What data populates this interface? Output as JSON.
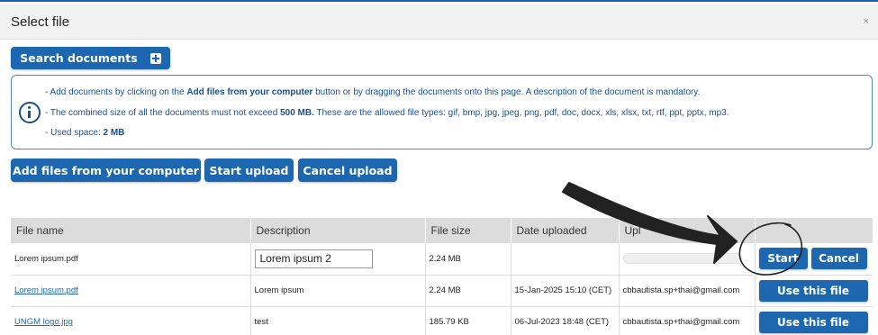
{
  "dialog": {
    "title": "Select file",
    "close_glyph": "×"
  },
  "toolbar": {
    "search_label": "Search documents",
    "add_files_label": "Add files from your computer",
    "start_upload_label": "Start upload",
    "cancel_upload_label": "Cancel upload"
  },
  "info": {
    "line1_pre": "- Add documents by clicking on the ",
    "line1_bold": "Add files from your computer",
    "line1_post": " button or by dragging the documents onto this page. A description of the document is mandatory.",
    "line2_pre": "- The combined size of all the documents must not exceed ",
    "line2_bold": "500 MB.",
    "line2_post": " These are the allowed file types: gif, bmp, jpg, jpeg, png, pdf, doc, docx, xls, xlsx, txt, rtf, ppt, pptx, mp3.",
    "line3_pre": "- Used space: ",
    "line3_bold": "2 MB"
  },
  "table": {
    "headers": [
      "File name",
      "Description",
      "File size",
      "Date uploaded",
      "Upl",
      ""
    ],
    "pending_row": {
      "file_name": "Lorem ipsum.pdf",
      "description_value": "Lorem ipsum 2",
      "file_size": "2.24 MB",
      "upload_progress": 0,
      "start_label": "Start",
      "cancel_label": "Cancel"
    },
    "rows": [
      {
        "file_name": "Lorem ipsum.pdf",
        "description": "Lorem ipsum",
        "file_size": "2.24 MB",
        "date_uploaded": "15-Jan-2025 15:10 (CET)",
        "uploaded_by": "cbbautista.sp+thai@gmail.com",
        "action_label": "Use this file"
      },
      {
        "file_name": "UNGM logo.jpg",
        "description": "test",
        "file_size": "185.79 KB",
        "date_uploaded": "06-Jul-2023 18:48 (CET)",
        "uploaded_by": "cbbautista.sp+thai@gmail.com",
        "action_label": "Use this file"
      }
    ]
  },
  "annotation": {
    "arrow_color": "#222222",
    "circle_color": "#222222"
  }
}
